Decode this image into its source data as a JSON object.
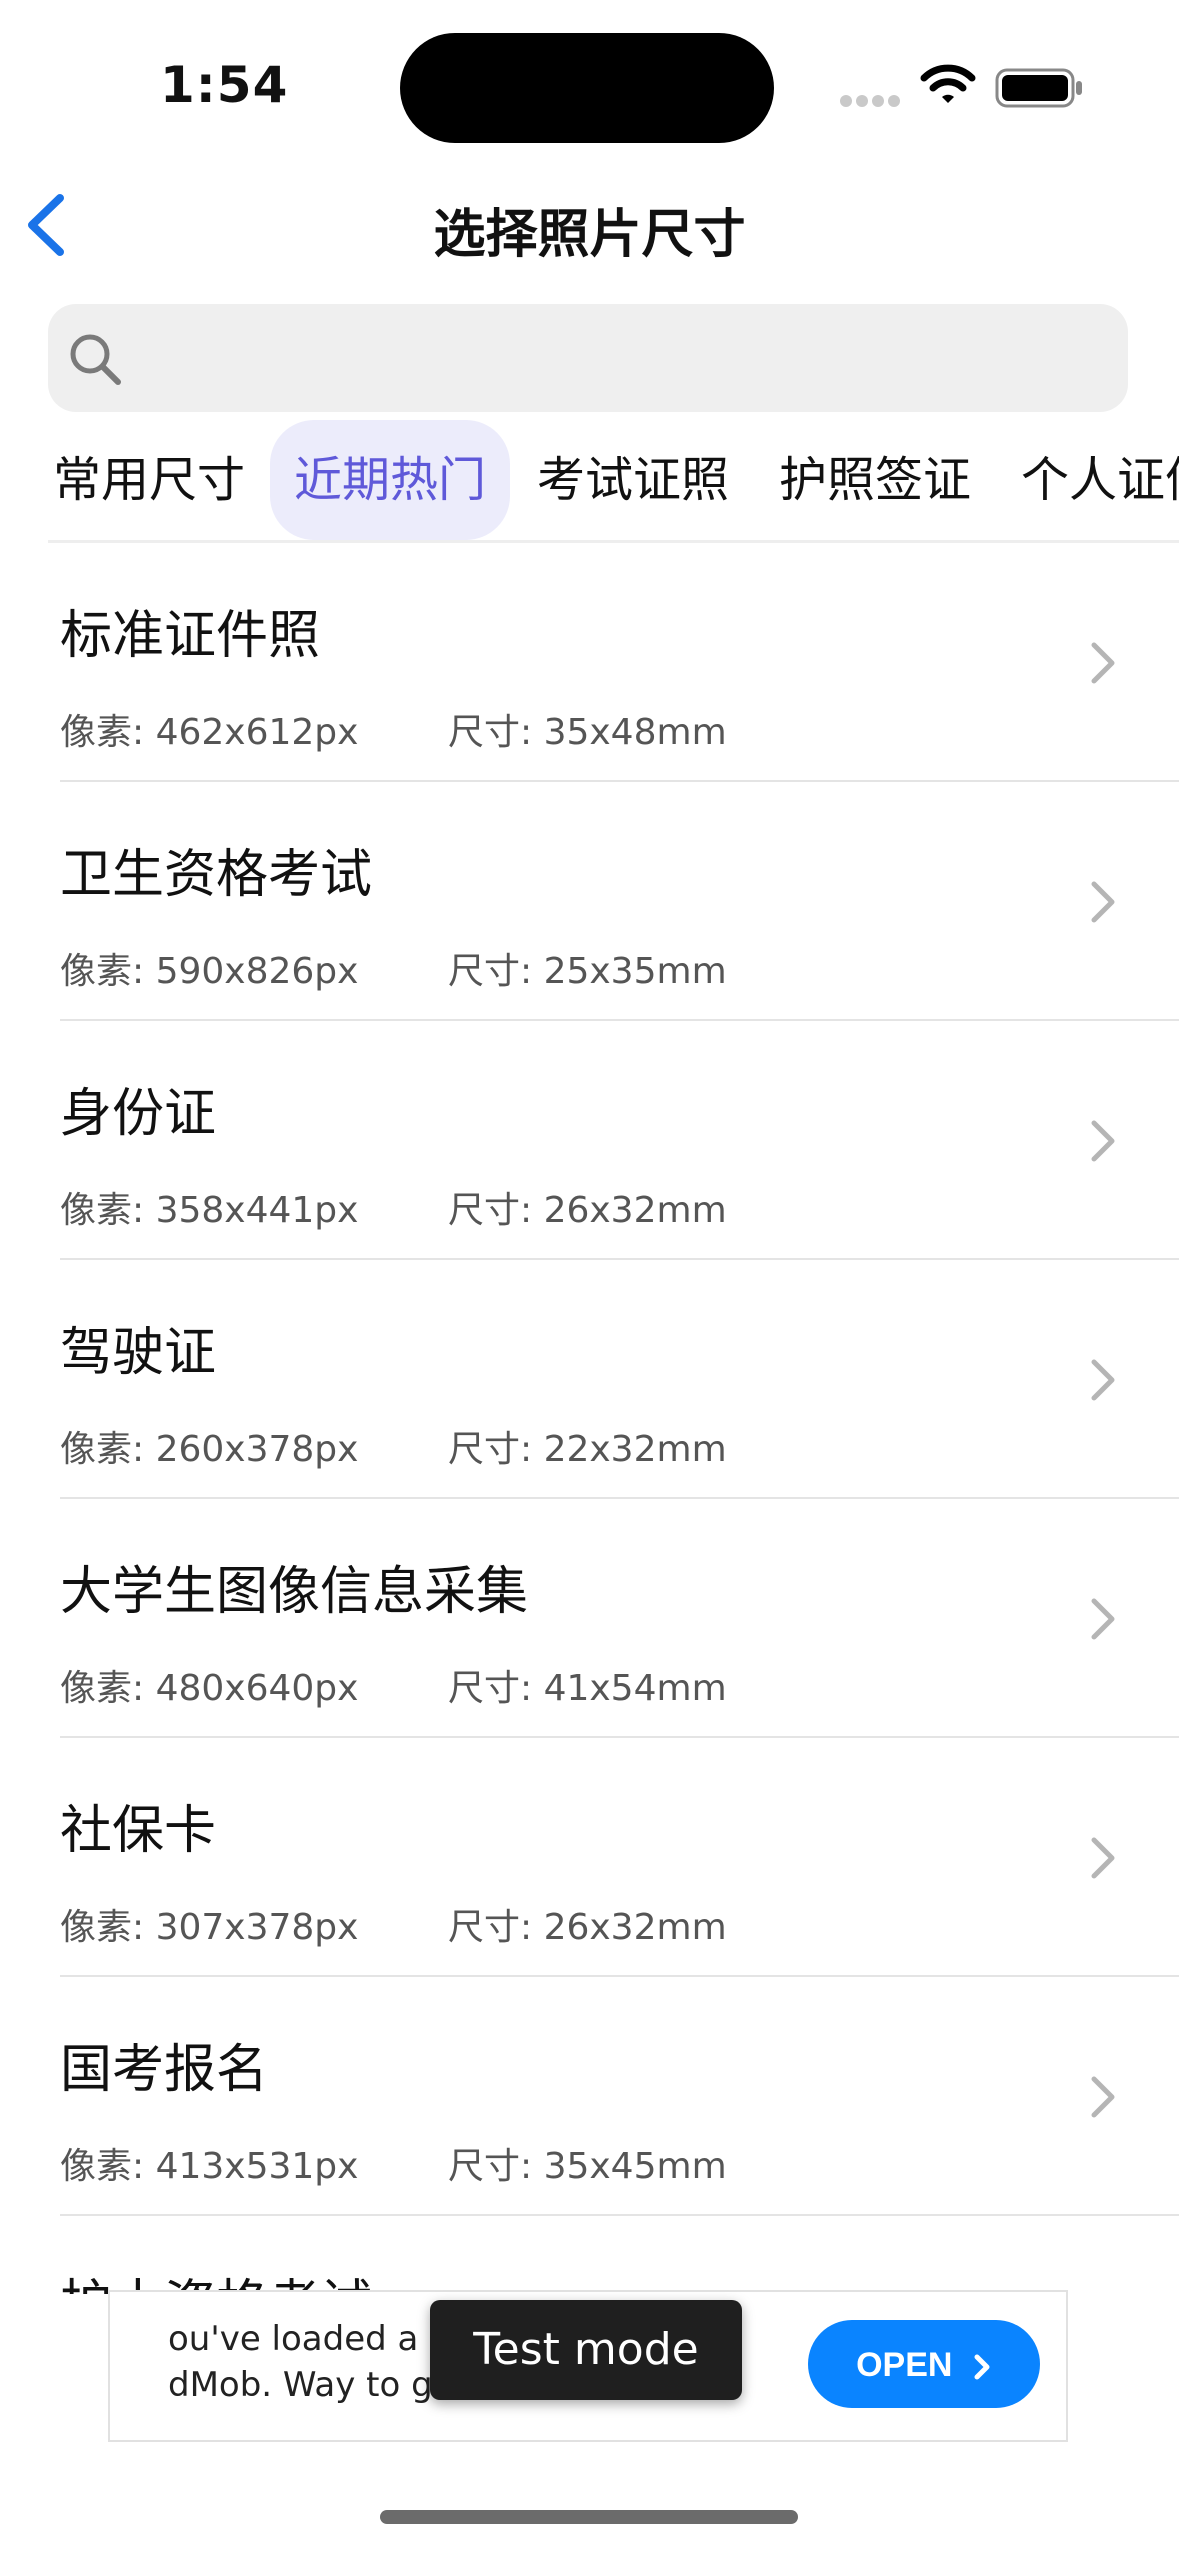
{
  "status_bar": {
    "time": "1:54"
  },
  "nav": {
    "title": "选择照片尺寸"
  },
  "search": {
    "placeholder": ""
  },
  "tabs": [
    {
      "label": "常用尺寸",
      "active": false
    },
    {
      "label": "近期热门",
      "active": true
    },
    {
      "label": "考试证照",
      "active": false
    },
    {
      "label": "护照签证",
      "active": false
    },
    {
      "label": "个人证件",
      "active": false
    }
  ],
  "list": [
    {
      "name": "标准证件照",
      "pixels": "像素: 462x612px",
      "size": "尺寸: 35x48mm"
    },
    {
      "name": "卫生资格考试",
      "pixels": "像素: 590x826px",
      "size": "尺寸: 25x35mm"
    },
    {
      "name": "身份证",
      "pixels": "像素: 358x441px",
      "size": "尺寸: 26x32mm"
    },
    {
      "name": "驾驶证",
      "pixels": "像素: 260x378px",
      "size": "尺寸: 22x32mm"
    },
    {
      "name": "大学生图像信息采集",
      "pixels": "像素: 480x640px",
      "size": "尺寸: 41x54mm"
    },
    {
      "name": "社保卡",
      "pixels": "像素: 307x378px",
      "size": "尺寸: 26x32mm"
    },
    {
      "name": "国考报名",
      "pixels": "像素: 413x531px",
      "size": "尺寸: 35x45mm"
    }
  ],
  "partial_item": "护士资格考试",
  "ad": {
    "text_line1": "ou've loaded a t",
    "text_line2": "dMob. Way to g",
    "open_label": "OPEN",
    "test_mode_label": "Test mode"
  },
  "colors": {
    "accent": "#5f59d9",
    "active_tab_bg": "#ececfb",
    "back_arrow": "#1a73e8",
    "ad_button": "#0a84ff"
  }
}
